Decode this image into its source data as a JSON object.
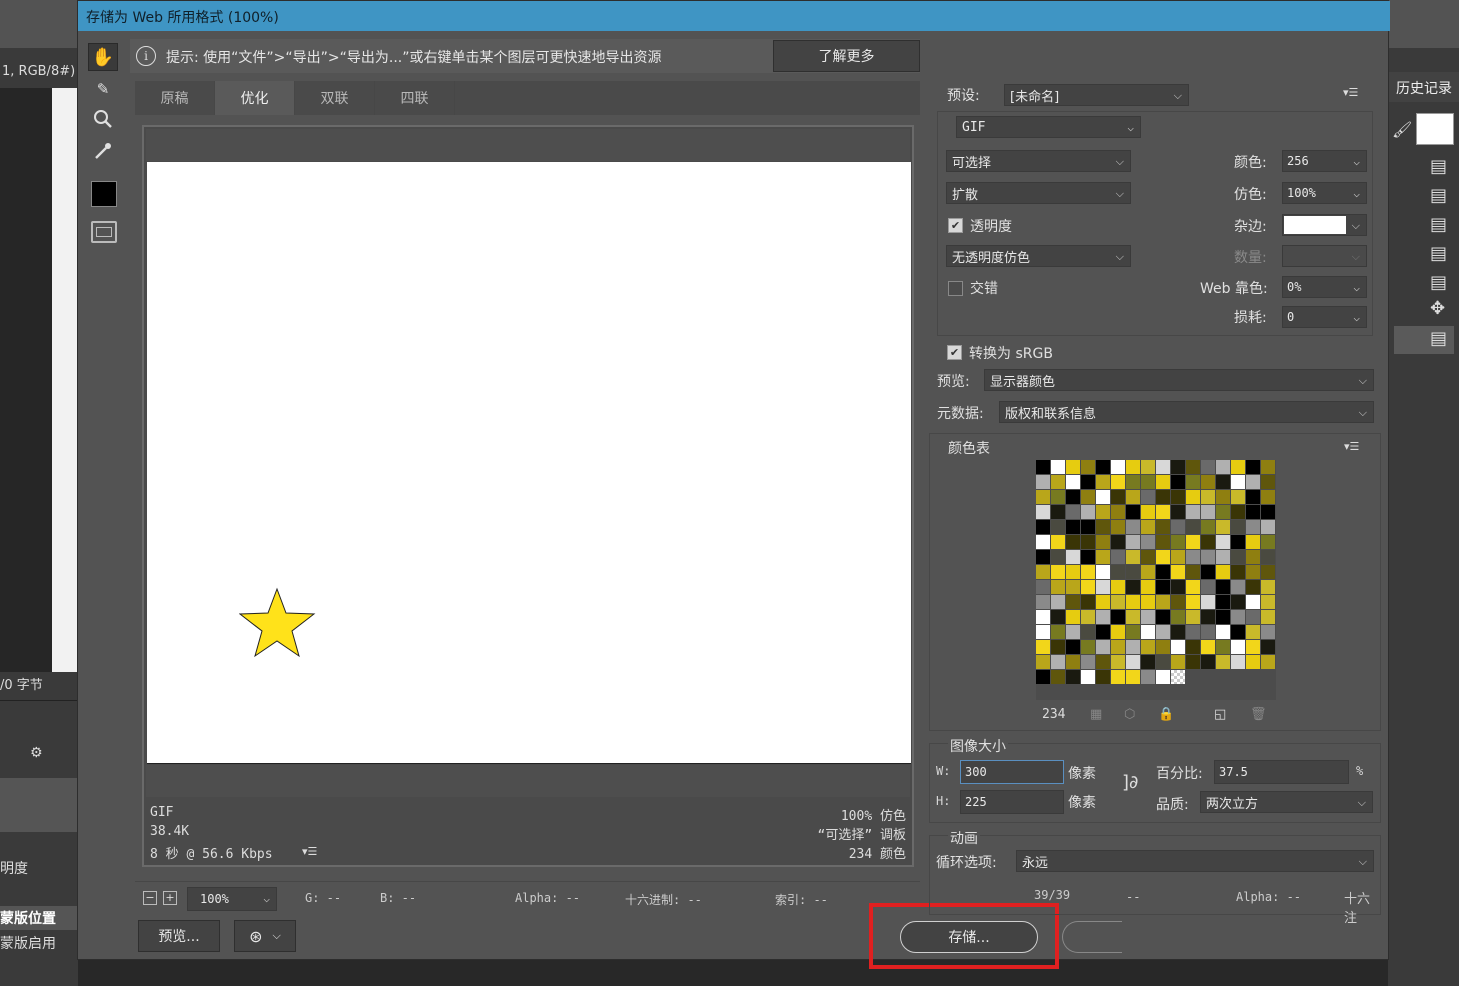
{
  "background": {
    "left_labels": [
      "1, RGB/8#)",
      "/0 字节",
      "明度",
      "蒙版位置",
      "蒙版启用"
    ],
    "history_title": "历史记录"
  },
  "dialog": {
    "title": "存储为 Web 所用格式 (100%)",
    "tip": "提示: 使用“文件”>“导出”>“导出为...”或右键单击某个图层可更快速地导出资源",
    "learn_more": "了解更多",
    "tabs": [
      "原稿",
      "优化",
      "双联",
      "四联"
    ],
    "active_tab": 1,
    "preview_info": {
      "format": "GIF",
      "size": "38.4K",
      "time": "8 秒 @ 56.6 Kbps",
      "dither": "100% 仿色",
      "palette": "“可选择” 调板",
      "colors": "234 颜色"
    },
    "statusbar": {
      "zoom": "100%",
      "g": "G: --",
      "b": "B: --",
      "alpha": "Alpha: --",
      "hex": "十六进制: --",
      "index": "索引: --"
    },
    "buttons": {
      "preview": "预览...",
      "save": "存储..."
    },
    "settings": {
      "preset_label": "预设:",
      "preset_value": "[未命名]",
      "format": "GIF",
      "reduction": "可选择",
      "dither_algo": "扩散",
      "colors_label": "颜色:",
      "colors_value": "256",
      "dither_label": "仿色:",
      "dither_value": "100%",
      "transparency_label": "透明度",
      "transparency_checked": true,
      "matte_label": "杂边:",
      "trans_dither": "无透明度仿色",
      "amount_label": "数量:",
      "interlaced_label": "交错",
      "interlaced_checked": false,
      "web_snap_label": "Web 靠色:",
      "web_snap_value": "0%",
      "lossy_label": "损耗:",
      "lossy_value": "0",
      "convert_srgb_label": "转换为 sRGB",
      "convert_srgb_checked": true,
      "preview_label": "预览:",
      "preview_value": "显示器颜色",
      "metadata_label": "元数据:",
      "metadata_value": "版权和联系信息"
    },
    "color_table": {
      "title": "颜色表",
      "count": "234"
    },
    "image_size": {
      "title": "图像大小",
      "w_label": "W:",
      "w_value": "300",
      "h_label": "H:",
      "h_value": "225",
      "unit": "像素",
      "percent_label": "百分比:",
      "percent_value": "37.5",
      "percent_unit": "%",
      "quality_label": "品质:",
      "quality_value": "两次立方"
    },
    "animation": {
      "title": "动画",
      "loop_label": "循环选项:",
      "loop_value": "永远",
      "frame": "39/39",
      "frame_extra": "--",
      "alpha": "Alpha: --",
      "hex_partial": "十六注"
    }
  },
  "colors": {
    "accent": "#3f95c4",
    "star": "#ffe21a",
    "highlight": "#e02020"
  }
}
